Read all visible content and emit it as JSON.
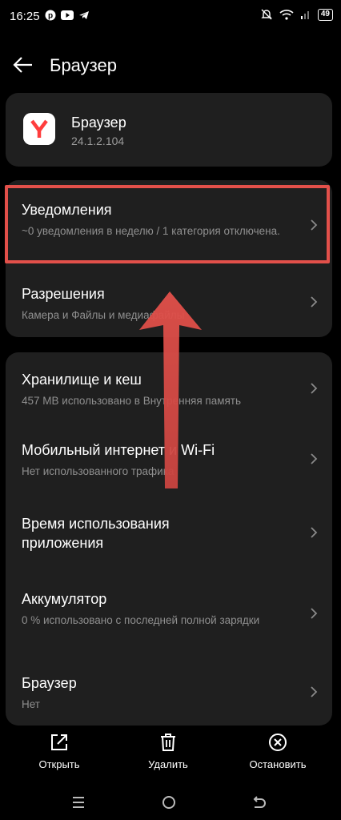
{
  "status_bar": {
    "time": "16:25",
    "battery": "49"
  },
  "header": {
    "title": "Браузер"
  },
  "app": {
    "name": "Браузер",
    "version": "24.1.2.104"
  },
  "permissions_card": {
    "notifications": {
      "title": "Уведомления",
      "subtitle": "~0 уведомления в неделю / 1 категория отключена."
    },
    "permissions": {
      "title": "Разрешения",
      "subtitle": "Камера и Файлы и медиафайлы"
    }
  },
  "misc_card": {
    "storage": {
      "title": "Хранилище и кеш",
      "subtitle": "457 MB использовано в Внутренняя память"
    },
    "mobile_data": {
      "title": "Мобильный интернет и Wi-Fi",
      "subtitle": "Нет использованного трафика"
    },
    "usage_time": {
      "title": "Время использования приложения"
    },
    "battery": {
      "title": "Аккумулятор",
      "subtitle": "0 % использовано с последней полной зарядки"
    },
    "browser": {
      "title": "Браузер",
      "subtitle": "Нет"
    }
  },
  "bottom_actions": {
    "open": "Открыть",
    "delete": "Удалить",
    "stop": "Остановить"
  },
  "colors": {
    "background": "#000000",
    "card": "#1f1f1f",
    "highlight": "#e2504a",
    "app_icon_accent": "#ff3d3d"
  }
}
